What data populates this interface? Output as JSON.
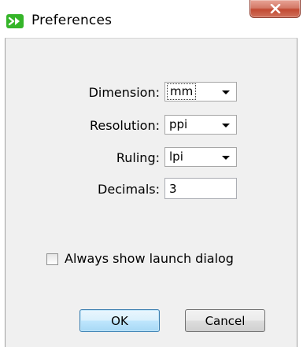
{
  "window": {
    "title": "Preferences",
    "close_glyph": "X",
    "icon": "app-logo-icon"
  },
  "form": {
    "dimension": {
      "label": "Dimension:",
      "value": "mm"
    },
    "resolution": {
      "label": "Resolution:",
      "value": "ppi"
    },
    "ruling": {
      "label": "Ruling:",
      "value": "lpi"
    },
    "decimals": {
      "label": "Decimals:",
      "value": "3"
    }
  },
  "options": {
    "always_show_launch_dialog": {
      "label": "Always show launch dialog",
      "checked": false
    }
  },
  "buttons": {
    "ok": "OK",
    "cancel": "Cancel"
  },
  "colors": {
    "close_button": "#c24a33",
    "app_icon": "#35b529",
    "default_button_border": "#3c7fb1"
  }
}
